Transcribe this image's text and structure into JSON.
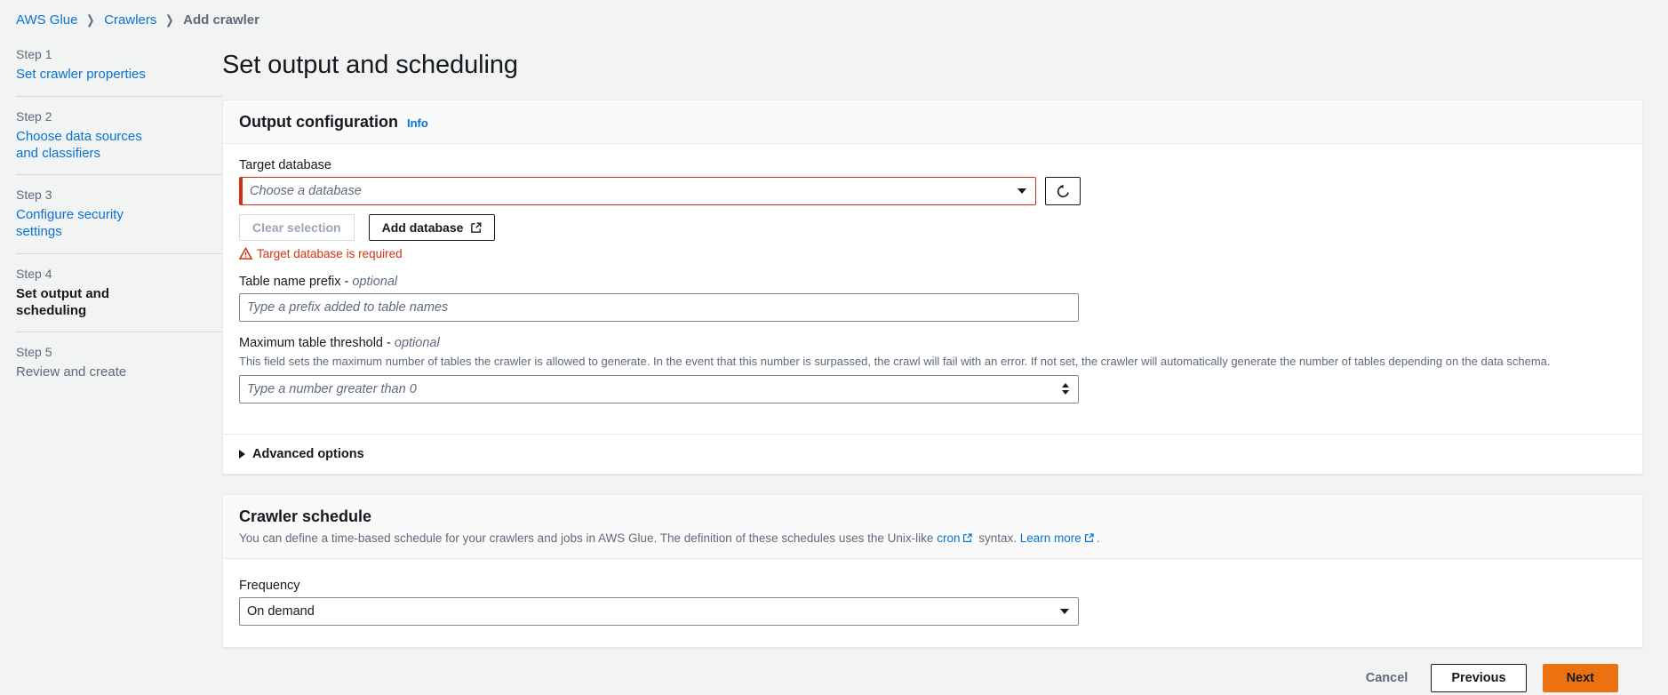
{
  "breadcrumb": {
    "items": [
      {
        "label": "AWS Glue",
        "current": false
      },
      {
        "label": "Crawlers",
        "current": false
      },
      {
        "label": "Add crawler",
        "current": true
      }
    ],
    "separator": "❯"
  },
  "sidebar": {
    "steps": [
      {
        "num": "Step 1",
        "label": "Set crawler properties",
        "state": "done"
      },
      {
        "num": "Step 2",
        "label": "Choose data sources and classifiers",
        "state": "done"
      },
      {
        "num": "Step 3",
        "label": "Configure security settings",
        "state": "done"
      },
      {
        "num": "Step 4",
        "label": "Set output and scheduling",
        "state": "active"
      },
      {
        "num": "Step 5",
        "label": "Review and create",
        "state": "future"
      }
    ]
  },
  "header": {
    "title": "Set output and scheduling"
  },
  "output_configuration": {
    "title": "Output configuration",
    "info_label": "Info",
    "target_database": {
      "label": "Target database",
      "placeholder": "Choose a database",
      "value": "",
      "error": "Target database is required",
      "refresh_icon": "refresh-icon",
      "clear_button": "Clear selection",
      "add_button": "Add database",
      "add_button_icon": "external-link-icon"
    },
    "table_name_prefix": {
      "label": "Table name prefix - ",
      "label_optional": "optional",
      "placeholder": "Type a prefix added to table names",
      "value": ""
    },
    "max_table_threshold": {
      "label": "Maximum table threshold - ",
      "label_optional": "optional",
      "description": "This field sets the maximum number of tables the crawler is allowed to generate. In the event that this number is surpassed, the crawl will fail with an error. If not set, the crawler will automatically generate the number of tables depending on the data schema.",
      "placeholder": "Type a number greater than 0",
      "value": ""
    },
    "advanced_options": {
      "label": "Advanced options",
      "expanded": false
    }
  },
  "crawler_schedule": {
    "title": "Crawler schedule",
    "description_part1": "You can define a time-based schedule for your crawlers and jobs in AWS Glue. The definition of these schedules uses the Unix-like ",
    "cron_link": "cron",
    "description_part2": " syntax. ",
    "learn_more_link": "Learn more",
    "description_part3": ".",
    "frequency": {
      "label": "Frequency",
      "value": "On demand"
    }
  },
  "footer": {
    "cancel_label": "Cancel",
    "previous_label": "Previous",
    "next_label": "Next"
  },
  "colors": {
    "link": "#0972d3",
    "error": "#d13212",
    "primary_button": "#ec7211",
    "page_background": "#f2f3f3"
  }
}
